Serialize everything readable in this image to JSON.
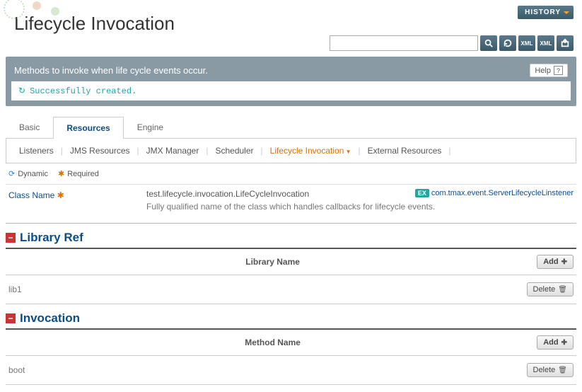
{
  "header": {
    "title": "Lifecycle Invocation",
    "history_label": "HISTORY"
  },
  "search": {
    "placeholder": "",
    "value": ""
  },
  "info": {
    "description": "Methods to invoke when life cycle events occur.",
    "help_label": "Help",
    "success_message": "Successfully created."
  },
  "tabs": [
    {
      "label": "Basic",
      "active": false
    },
    {
      "label": "Resources",
      "active": true
    },
    {
      "label": "Engine",
      "active": false
    }
  ],
  "subnav": [
    {
      "label": "Listeners",
      "active": false
    },
    {
      "label": "JMS Resources",
      "active": false
    },
    {
      "label": "JMX Manager",
      "active": false
    },
    {
      "label": "Scheduler",
      "active": false
    },
    {
      "label": "Lifecycle Invocation",
      "active": true
    },
    {
      "label": "External Resources",
      "active": false
    }
  ],
  "legend": {
    "dynamic_label": "Dynamic",
    "required_label": "Required"
  },
  "class_field": {
    "label": "Class Name",
    "value": "test.lifecycle.invocation.LifeCycleInvocation",
    "hint": "Fully qualified name of the class which handles callbacks for lifecycle events.",
    "example_badge": "EX",
    "example_value": "com.tmax.event.ServerLifecycleLinstener"
  },
  "sections": {
    "library_ref": {
      "title": "Library Ref",
      "column_label": "Library Name",
      "add_label": "Add",
      "delete_label": "Delete",
      "rows": [
        {
          "name": "lib1"
        }
      ]
    },
    "invocation": {
      "title": "Invocation",
      "column_label": "Method Name",
      "add_label": "Add",
      "delete_label": "Delete",
      "rows": [
        {
          "name": "boot"
        }
      ]
    }
  }
}
